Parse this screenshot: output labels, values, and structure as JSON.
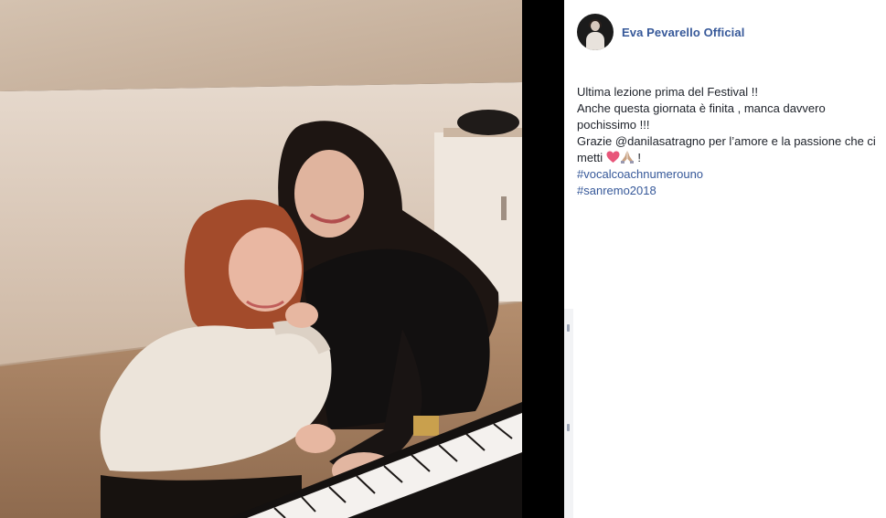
{
  "post": {
    "author": "Eva Pevarello Official",
    "caption": {
      "line1": "Ultima lezione prima del Festival !!",
      "line2": "Anche questa giornata è finita , manca davvero pochissimo !!!",
      "line3_start": "Grazie @danilasatragno per l’amore e la passione che ci metti",
      "line3_end": " !",
      "hashtags": [
        "#vocalcoachnumerouno",
        "#sanremo2018"
      ]
    },
    "emoji_icons": [
      "heart-icon",
      "praying-hands-icon"
    ]
  },
  "photo": {
    "description_icon": "photo-two-women-at-piano"
  },
  "colors": {
    "link": "#365899",
    "text": "#1d2129",
    "background": "#000000",
    "panel": "#ffffff"
  }
}
